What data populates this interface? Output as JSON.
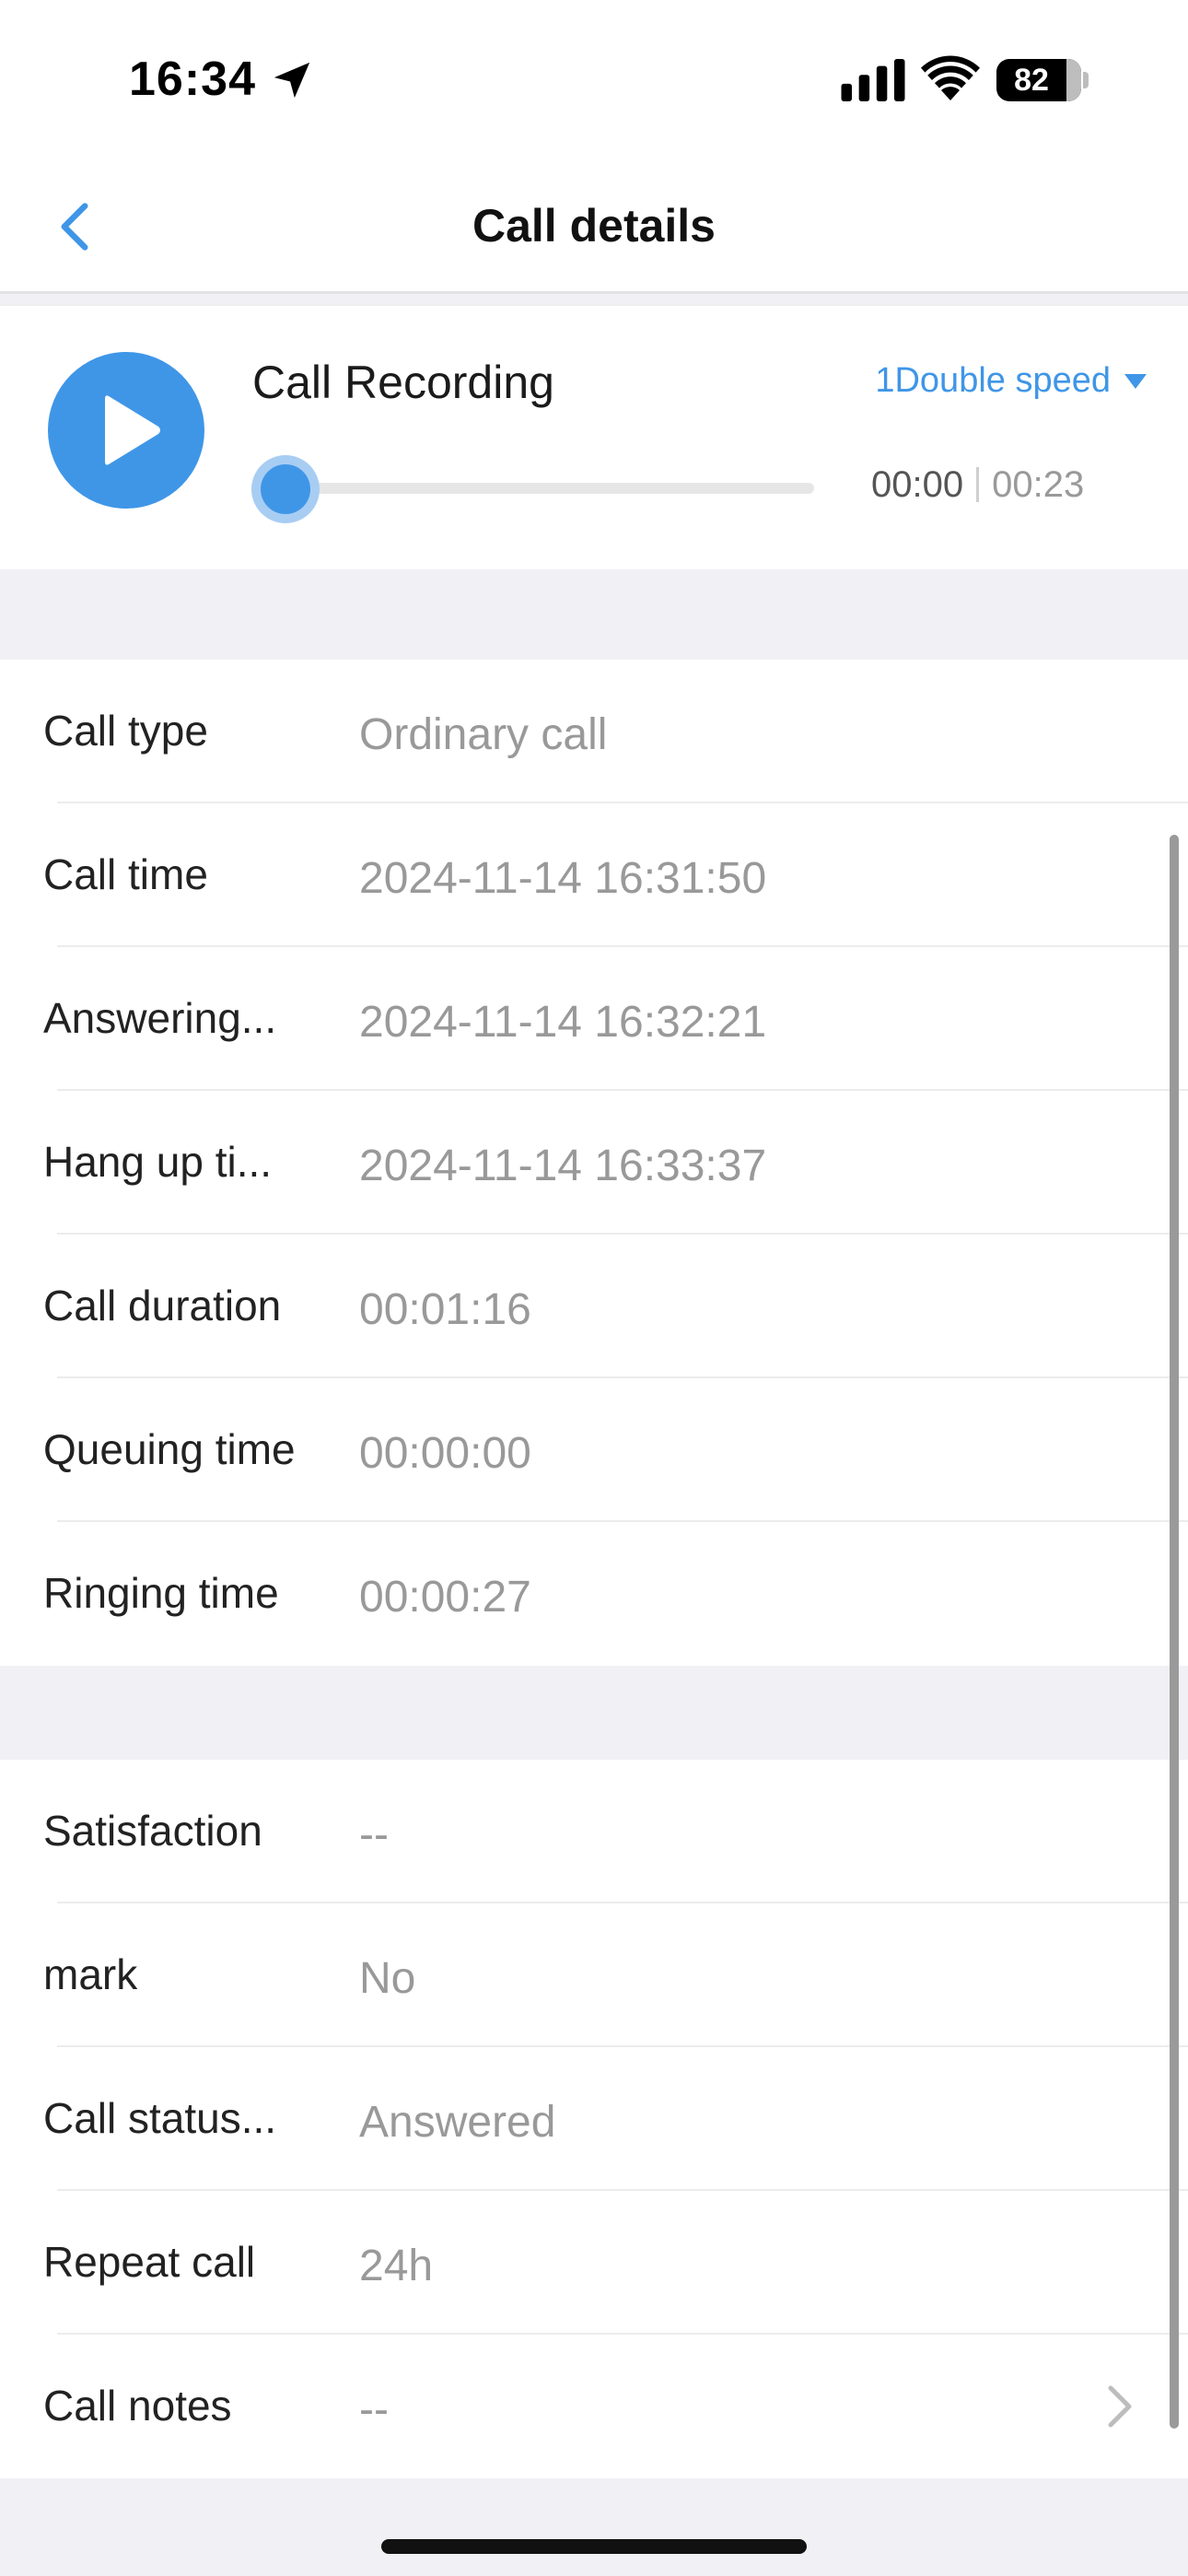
{
  "status_bar": {
    "time": "16:34",
    "battery": "82",
    "icons": [
      "location-arrow-icon",
      "signal-icon",
      "wifi-icon",
      "battery-icon"
    ]
  },
  "nav": {
    "title": "Call details",
    "back_icon": "chevron-left-icon"
  },
  "recording": {
    "title": "Call Recording",
    "speed_label": "1Double speed",
    "current_time": "00:00",
    "total_time": "00:23",
    "progress": 0,
    "play_icon": "play-icon"
  },
  "call_info": [
    {
      "label": "Call type",
      "value": "Ordinary call"
    },
    {
      "label": "Call time",
      "value": "2024-11-14 16:31:50"
    },
    {
      "label": "Answering...",
      "value": "2024-11-14 16:32:21"
    },
    {
      "label": "Hang up ti...",
      "value": "2024-11-14 16:33:37"
    },
    {
      "label": "Call duration",
      "value": "00:01:16"
    },
    {
      "label": "Queuing time",
      "value": "00:00:00"
    },
    {
      "label": "Ringing time",
      "value": "00:00:27"
    }
  ],
  "call_extra": [
    {
      "label": "Satisfaction",
      "value": "--"
    },
    {
      "label": "mark",
      "value": "No"
    },
    {
      "label": "Call status...",
      "value": "Answered"
    },
    {
      "label": "Repeat call",
      "value": "24h"
    },
    {
      "label": "Call notes",
      "value": "--"
    }
  ],
  "colors": {
    "accent": "#3f96e7",
    "background": "#f0f0f5",
    "value_text": "#999999"
  }
}
